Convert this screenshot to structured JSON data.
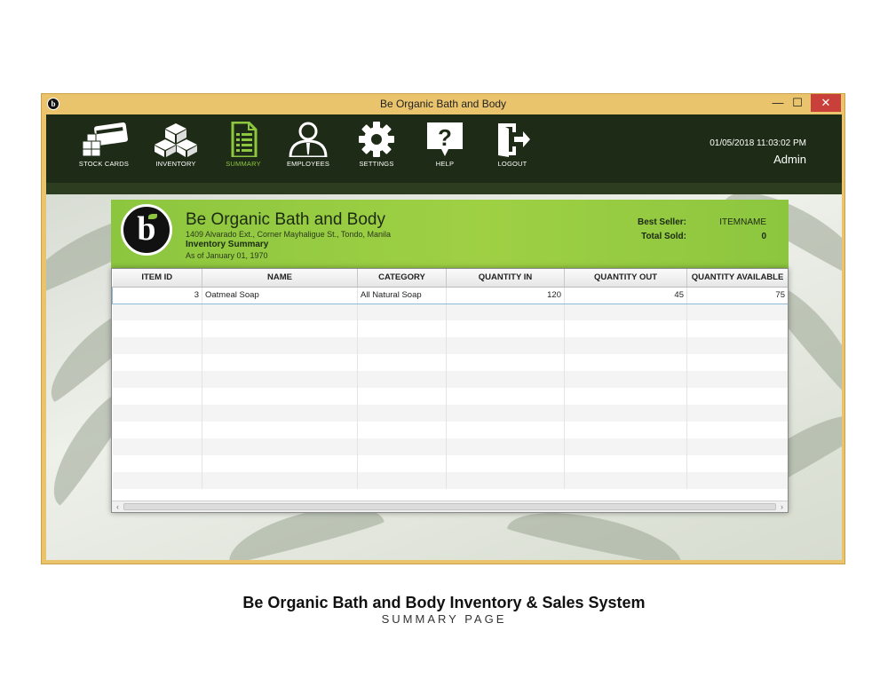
{
  "window": {
    "title": "Be Organic Bath and Body",
    "controls": {
      "minimize": "—",
      "maximize": "☐",
      "close": "✕"
    }
  },
  "toolbar": {
    "items": [
      {
        "label": "STOCK CARDS",
        "icon": "stock-cards-icon"
      },
      {
        "label": "INVENTORY",
        "icon": "boxes-icon"
      },
      {
        "label": "SUMMARY",
        "icon": "document-icon",
        "active": true
      },
      {
        "label": "EMPLOYEES",
        "icon": "user-icon"
      },
      {
        "label": "SETTINGS",
        "icon": "gear-icon"
      },
      {
        "label": "HELP",
        "icon": "help-icon"
      },
      {
        "label": "LOGOUT",
        "icon": "logout-icon"
      }
    ],
    "datetime": "01/05/2018  11:03:02 PM",
    "user": "Admin"
  },
  "report": {
    "logo_text": "b",
    "company": "Be Organic Bath and Body",
    "address": "1409 Alvarado Ext., Corner Mayhaligue St., Tondo, Manila",
    "title": "Inventory Summary",
    "date": "As of January 01, 1970",
    "best_seller_label": "Best Seller:",
    "best_seller_value": "ITEMNAME",
    "total_sold_label": "Total Sold:",
    "total_sold_value": "0"
  },
  "table": {
    "columns": [
      "ITEM ID",
      "NAME",
      "CATEGORY",
      "QUANTITY IN",
      "QUANTITY OUT",
      "QUANTITY AVAILABLE"
    ],
    "rows": [
      [
        "3",
        "Oatmeal Soap",
        "All Natural Soap",
        "120",
        "45",
        "75"
      ]
    ]
  },
  "caption": {
    "title": "Be Organic Bath and Body Inventory & Sales System",
    "subtitle": "SUMMARY PAGE"
  },
  "colors": {
    "toolbar_bg": "#1e2c17",
    "accent_green": "#8cc63f",
    "window_frame": "#e9c46d",
    "close_red": "#c9403a"
  }
}
